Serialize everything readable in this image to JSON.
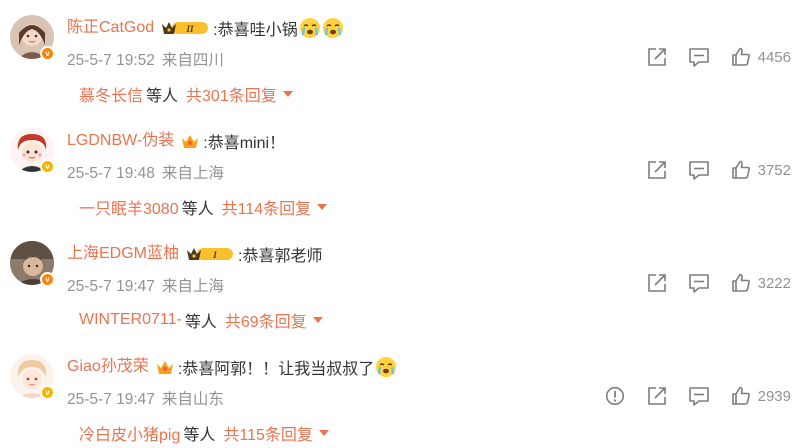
{
  "comments": [
    {
      "username": "陈正CatGod",
      "level": "II",
      "text": ":恭喜哇小锅",
      "emojis": [
        "cry-emoji",
        "cry-emoji"
      ],
      "date": "25-5-7 19:52",
      "location": "来自四川",
      "likes": "4456",
      "reply_user": "慕冬长信",
      "reply_mid": "等人",
      "reply_count": "共301条回复",
      "badge": "orange",
      "show_report": false
    },
    {
      "username": "LGDNBW-伪装",
      "level": "",
      "text": ":恭喜mini！",
      "emojis": [],
      "date": "25-5-7 19:48",
      "location": "来自上海",
      "likes": "3752",
      "reply_user": "一只眠羊3080",
      "reply_mid": "等人",
      "reply_count": "共114条回复",
      "badge": "yellow",
      "show_report": false
    },
    {
      "username": "上海EDGM蓝柚",
      "level": "I",
      "text": ":恭喜郭老师",
      "emojis": [],
      "date": "25-5-7 19:47",
      "location": "来自上海",
      "likes": "3222",
      "reply_user": "WINTER0711-",
      "reply_mid": "等人",
      "reply_count": "共69条回复",
      "badge": "orange",
      "show_report": false
    },
    {
      "username": "Giao孙茂荣",
      "level": "",
      "text": ":恭喜阿郭！！让我当叔叔了",
      "emojis": [
        "cry-emoji"
      ],
      "date": "25-5-7 19:47",
      "location": "来自山东",
      "likes": "2939",
      "reply_user": "冷白皮小猪pig",
      "reply_mid": "等人",
      "reply_count": "共115条回复",
      "badge": "yellow",
      "show_report": true
    }
  ],
  "colors": {
    "accent": "#eb7350",
    "meta": "#939393",
    "badge_orange": "#ff8200",
    "badge_yellow": "#f7b500"
  }
}
